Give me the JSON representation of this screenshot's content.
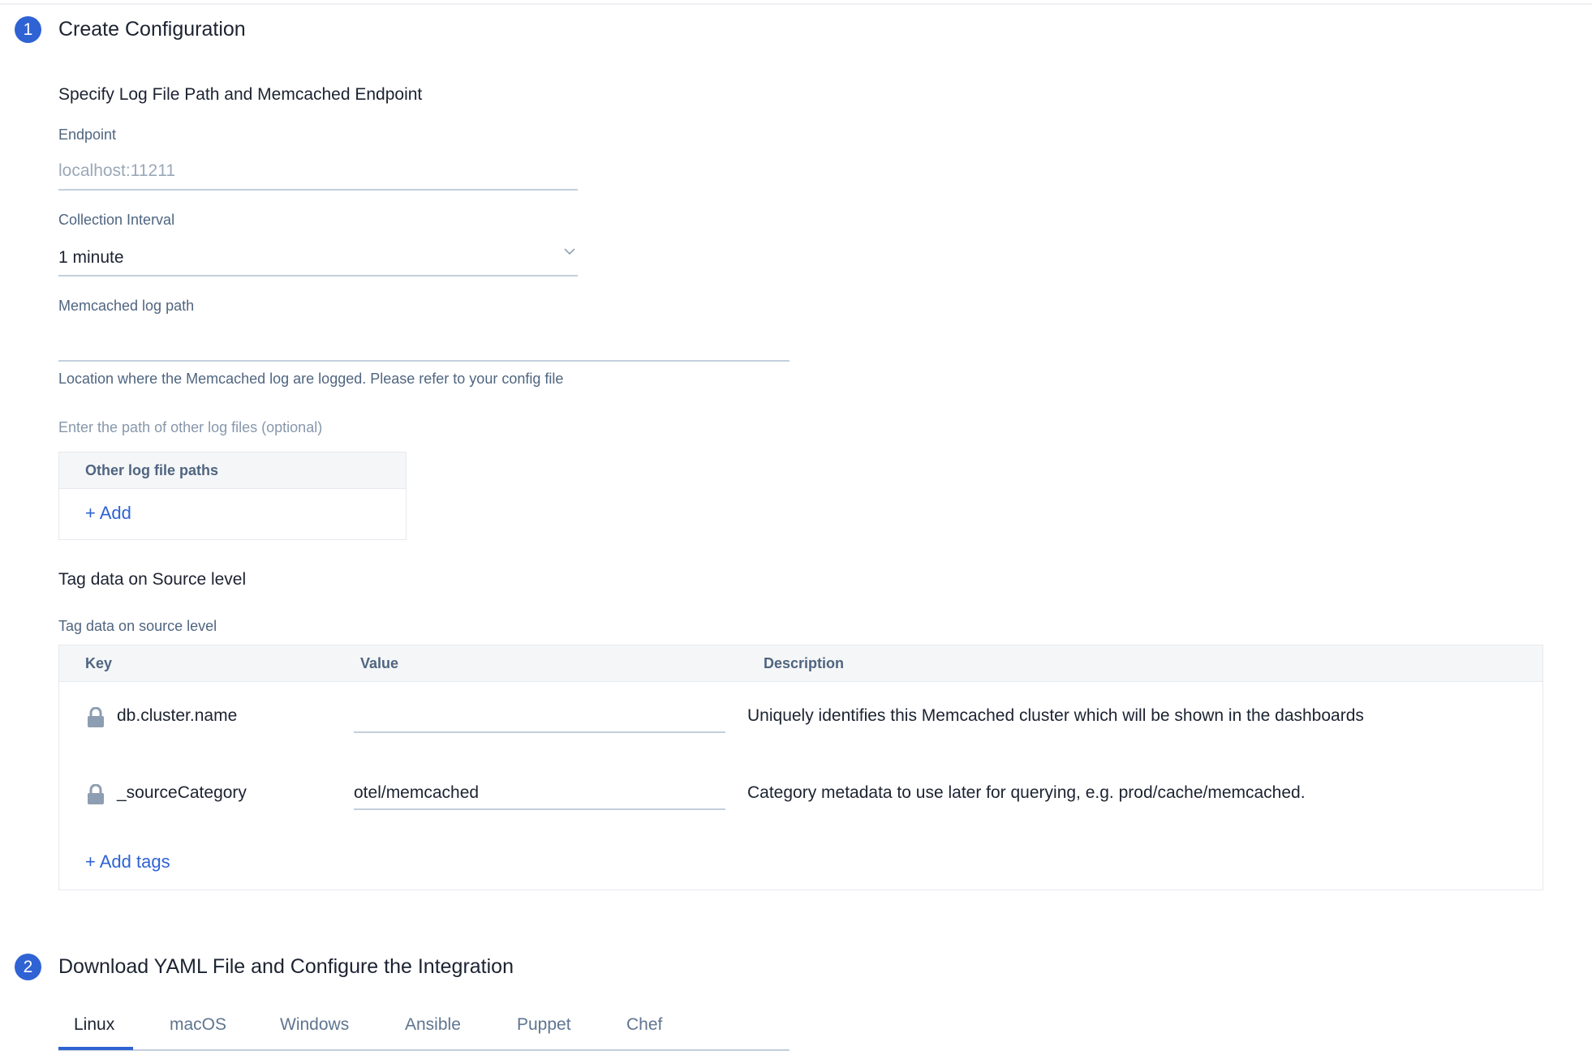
{
  "section1": {
    "step": "1",
    "title": "Create Configuration",
    "subtitle": "Specify Log File Path and Memcached Endpoint",
    "endpoint": {
      "label": "Endpoint",
      "placeholder": "localhost:11211",
      "value": ""
    },
    "interval": {
      "label": "Collection Interval",
      "value": "1 minute"
    },
    "log_path": {
      "label": "Memcached log path",
      "value": "",
      "helper": "Location where the Memcached log are logged. Please refer to your config file"
    },
    "other_paths": {
      "hint": "Enter the path of other log files (optional)",
      "header": "Other log file paths",
      "add_label": "+ Add"
    },
    "tags": {
      "title": "Tag data on Source level",
      "label": "Tag data on source level",
      "columns": [
        "Key",
        "Value",
        "Description"
      ],
      "rows": [
        {
          "key": "db.cluster.name",
          "value": "",
          "description": "Uniquely identifies this Memcached cluster which will be shown in the dashboards"
        },
        {
          "key": "_sourceCategory",
          "value": "otel/memcached",
          "description": "Category metadata to use later for querying, e.g. prod/cache/memcached."
        }
      ],
      "add_label": "+ Add tags"
    }
  },
  "section2": {
    "step": "2",
    "title": "Download YAML File and Configure the Integration",
    "tabs": [
      "Linux",
      "macOS",
      "Windows",
      "Ansible",
      "Puppet",
      "Chef"
    ],
    "active_tab": "Linux"
  },
  "colors": {
    "accent": "#2f63d4",
    "label": "#4f6580"
  }
}
